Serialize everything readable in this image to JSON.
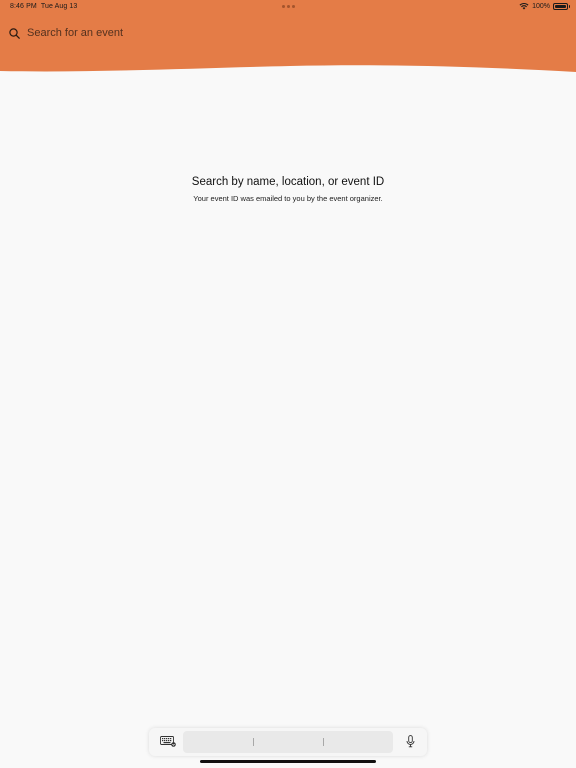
{
  "status_bar": {
    "time": "8:46 PM",
    "date": "Tue Aug 13",
    "battery_label": "100%",
    "battery_level": 1.0,
    "wifi_icon": "wifi-icon",
    "battery_icon": "battery-icon"
  },
  "header": {
    "background_color": "#E47C47",
    "search_icon": "search-icon"
  },
  "search": {
    "placeholder": "Search for an event",
    "value": ""
  },
  "empty_state": {
    "title": "Search by name, location, or event ID",
    "subtitle": "Your event ID was emailed to you by the event organizer."
  },
  "keyboard_bar": {
    "keyboard_icon": "keyboard-icon",
    "mic_icon": "microphone-icon",
    "suggestions": [
      "",
      "",
      ""
    ]
  }
}
